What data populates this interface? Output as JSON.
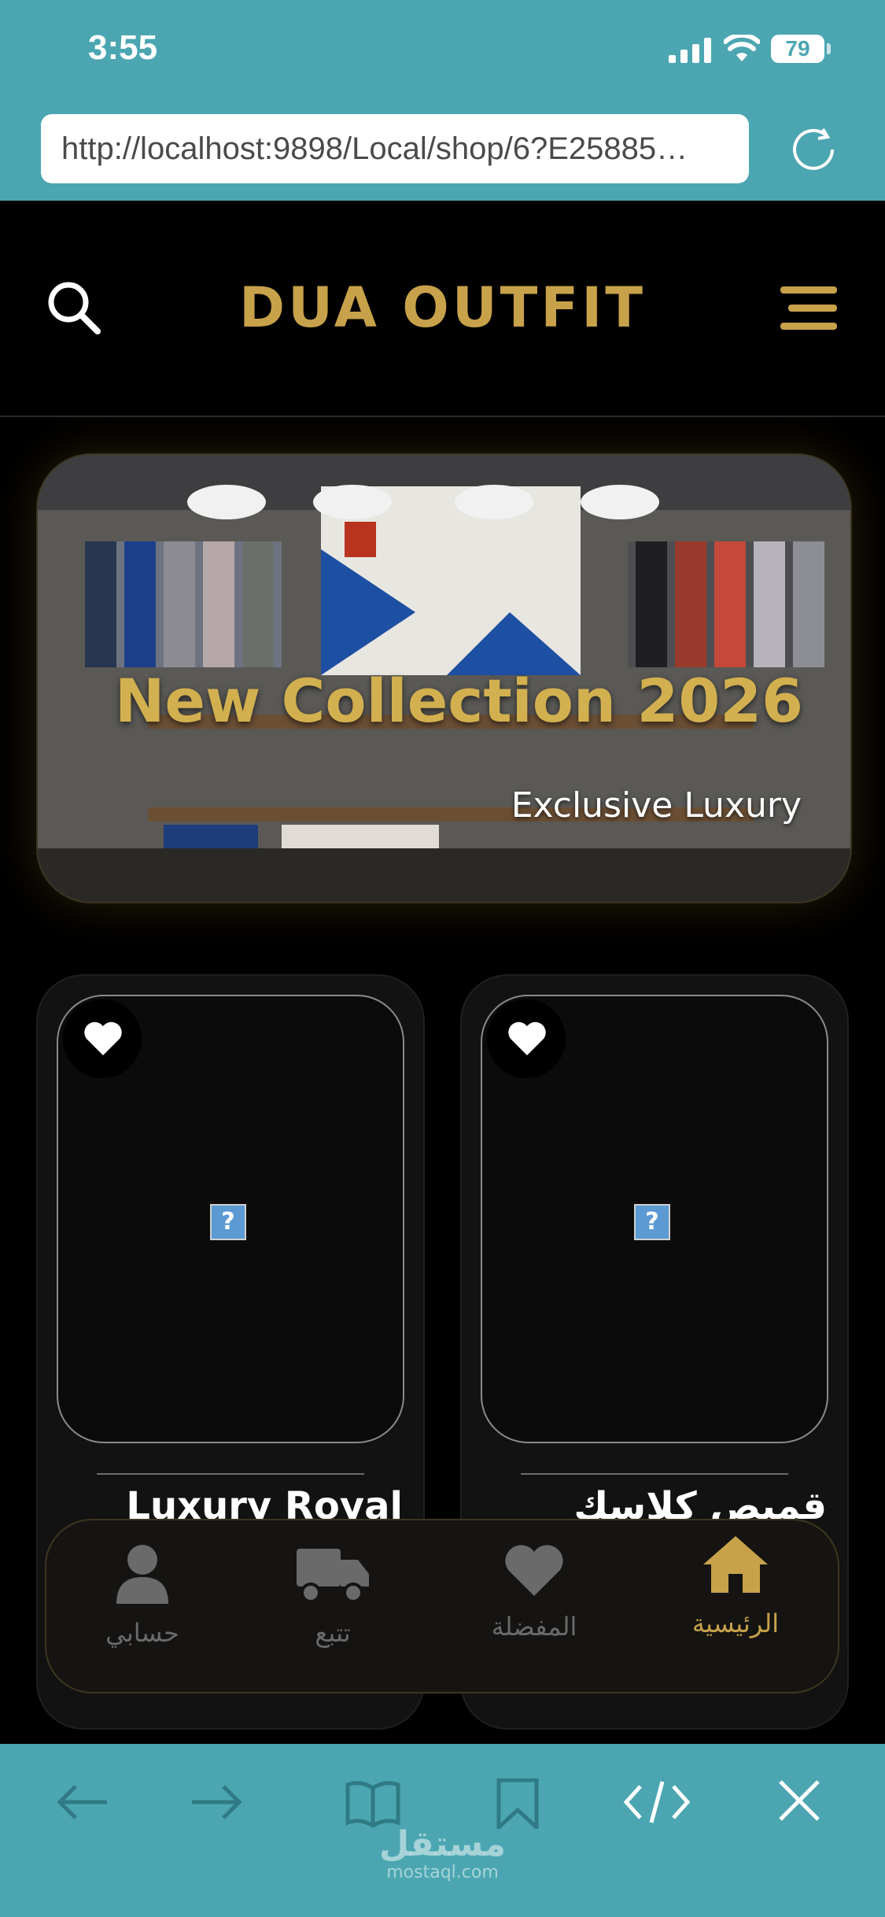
{
  "status_bar": {
    "time": "3:55",
    "battery": "79"
  },
  "browser": {
    "url": "http://localhost:9898/Local/shop/6?E25885…"
  },
  "header": {
    "brand": "DUA OUTFIT"
  },
  "banner": {
    "title": "New Collection 2026",
    "subtitle": "Exclusive Luxury"
  },
  "products": [
    {
      "title": "Luxury Royal"
    },
    {
      "title": "قميص كلاسك"
    }
  ],
  "bottom_nav": {
    "items": [
      {
        "label": "حسابي",
        "icon": "person-icon",
        "active": false
      },
      {
        "label": "تتبع",
        "icon": "truck-icon",
        "active": false
      },
      {
        "label": "المفضلة",
        "icon": "heart-icon",
        "active": false
      },
      {
        "label": "الرئيسية",
        "icon": "home-icon",
        "active": true
      }
    ]
  },
  "watermark": {
    "arabic": "مستقل",
    "latin": "mostaql.com"
  },
  "colors": {
    "accent": "#c7a24a",
    "browser_bar": "#4ba6b1",
    "inactive": "#6a6a6a"
  }
}
